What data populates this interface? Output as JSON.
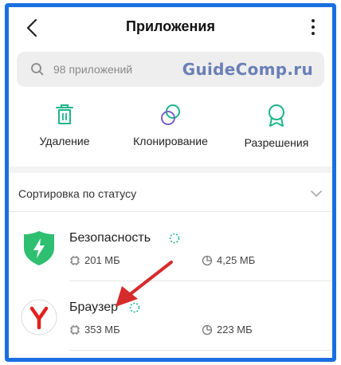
{
  "header": {
    "title": "Приложения"
  },
  "search": {
    "placeholder": "98 приложений"
  },
  "watermark": {
    "text": "GuideComp.ru"
  },
  "actions": [
    {
      "label": "Удаление",
      "icon": "trash-icon"
    },
    {
      "label": "Клонирование",
      "icon": "clone-circles-icon"
    },
    {
      "label": "Разрешения",
      "icon": "award-ribbon-icon"
    }
  ],
  "sort": {
    "label": "Сортировка по статусу"
  },
  "apps": [
    {
      "name": "Безопасность",
      "storage": "201 МБ",
      "cache": "4,25 МБ",
      "icon": "security-shield-icon"
    },
    {
      "name": "Браузер",
      "storage": "353 МБ",
      "cache": "223 МБ",
      "icon": "yandex-browser-icon"
    }
  ],
  "colors": {
    "border": "#1a6fe0",
    "accent": "#1db58a",
    "security_green": "#2fbf71",
    "yandex_red": "#e1211e",
    "arrow_red": "#d62b2b"
  }
}
